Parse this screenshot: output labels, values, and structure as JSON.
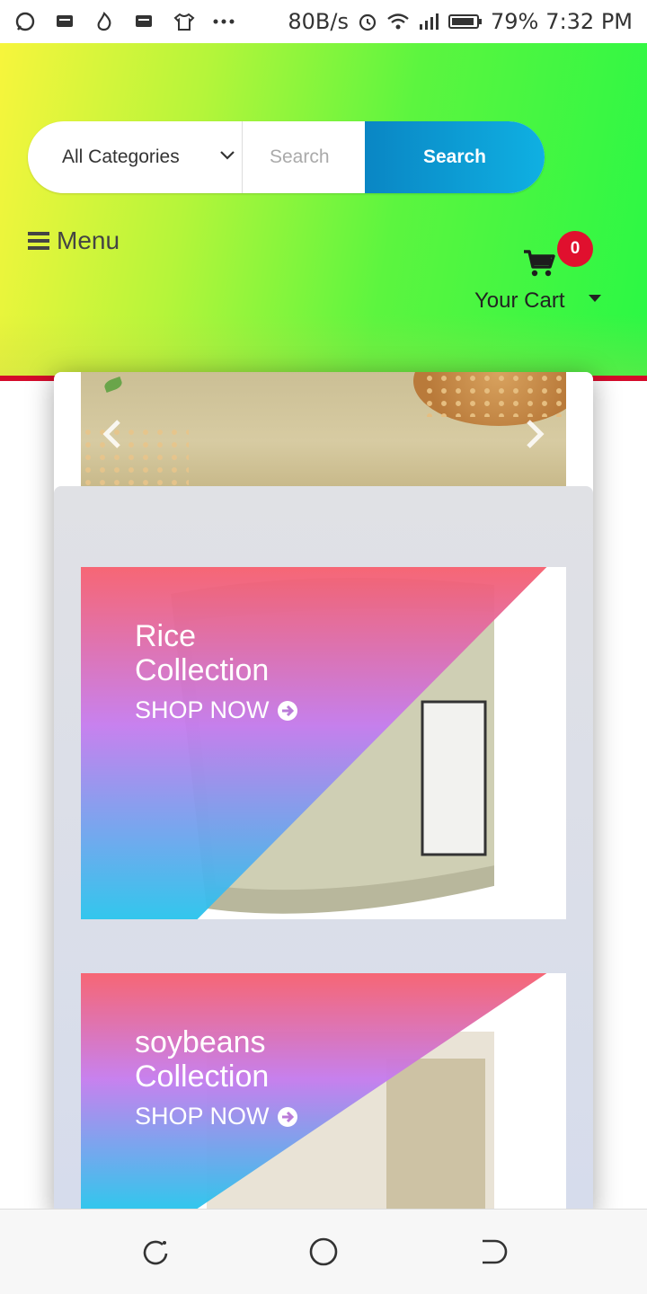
{
  "status_bar": {
    "speed": "80B/s",
    "battery": "79%",
    "time": "7:32 PM",
    "icons": [
      "chat-icon",
      "message-icon",
      "flame-icon",
      "message-icon",
      "shirt-icon",
      "more-icon",
      "alarm-icon",
      "wifi-icon",
      "signal-icon",
      "battery-icon"
    ]
  },
  "search": {
    "category": "All Categories",
    "placeholder": "Search",
    "button": "Search"
  },
  "menu": {
    "label": "Menu"
  },
  "cart": {
    "label": "Your Cart",
    "count": "0"
  },
  "promos": [
    {
      "title": "Rice\nCollection",
      "cta": "SHOP NOW"
    },
    {
      "title": "soybeans\nCollection",
      "cta": "SHOP NOW"
    }
  ],
  "colors": {
    "accent_blue": "#0a86c4",
    "badge_red": "#e0102e",
    "header_green": "#2af845",
    "header_yellow": "#f7f53c"
  }
}
